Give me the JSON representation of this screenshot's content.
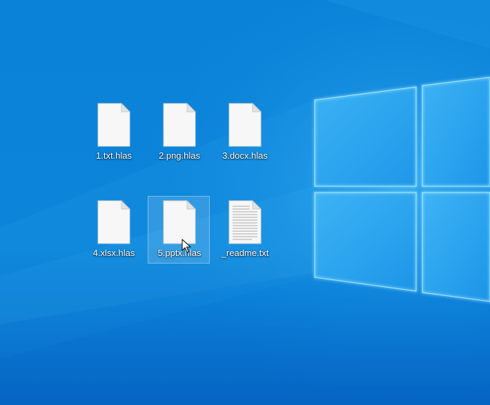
{
  "desktop": {
    "icons": [
      {
        "label": "1.txt.hlas",
        "type": "blank",
        "selected": false
      },
      {
        "label": "2.png.hlas",
        "type": "blank",
        "selected": false
      },
      {
        "label": "3.docx.hlas",
        "type": "blank",
        "selected": false
      },
      {
        "label": "4.xlsx.hlas",
        "type": "blank",
        "selected": false
      },
      {
        "label": "5.pptx.hlas",
        "type": "blank",
        "selected": true
      },
      {
        "label": "_readme.txt",
        "type": "text-document",
        "selected": false
      }
    ],
    "cursor": "arrow-pointer-icon"
  },
  "colors": {
    "background": "#0a7fd6",
    "window_pane": "#2aa6f0",
    "window_glow": "#8fe4ff",
    "label_text": "#ffffff"
  }
}
